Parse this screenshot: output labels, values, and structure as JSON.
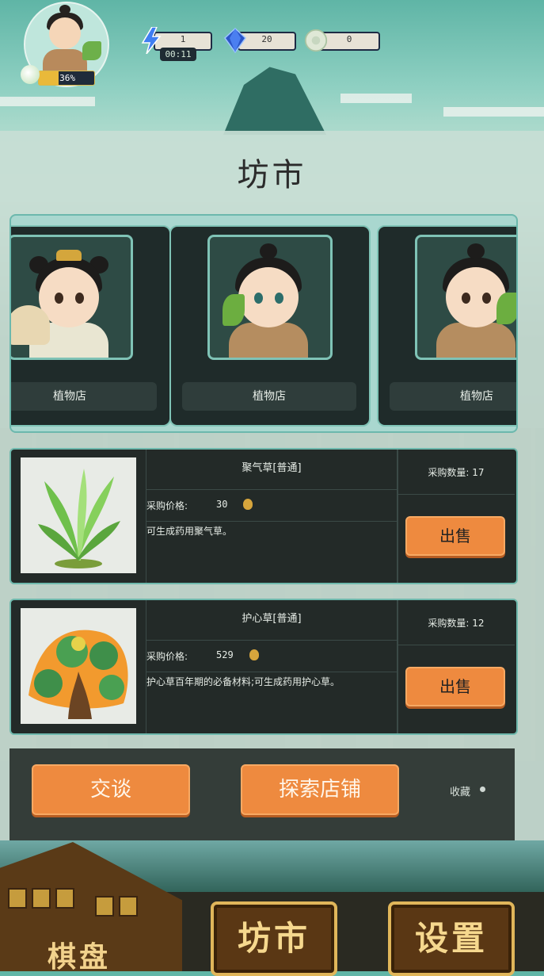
{
  "hud": {
    "progress_text": "36%",
    "progress_fraction": 0.36,
    "energy_value": "1",
    "energy_timer": "00:11",
    "gem_value": "20",
    "jade_value": "0"
  },
  "title": "坊市",
  "npcs": [
    {
      "label": "植物店"
    },
    {
      "label": "植物店"
    },
    {
      "label": "植物店"
    }
  ],
  "items": [
    {
      "name": "聚气草[普通]",
      "price_label": "采购价格:",
      "price": "30",
      "desc": "可生成药用聚气草。",
      "qty_label": "采购数量: 17",
      "sell_label": "出售"
    },
    {
      "name": "护心草[普通]",
      "price_label": "采购价格:",
      "price": "529",
      "desc": "护心草百年期的必备材料;可生成药用护心草。",
      "qty_label": "采购数量: 12",
      "sell_label": "出售"
    }
  ],
  "actions": {
    "talk_label": "交谈",
    "explore_label": "探索店铺",
    "favorite_label": "收藏"
  },
  "bottom_nav": {
    "board_label": "棋盘",
    "market_label": "坊市",
    "settings_label": "设置"
  },
  "colors": {
    "accent_orange": "#ee8a3f",
    "panel_teal": "#6fb9ad",
    "gold": "#e0b65a"
  }
}
